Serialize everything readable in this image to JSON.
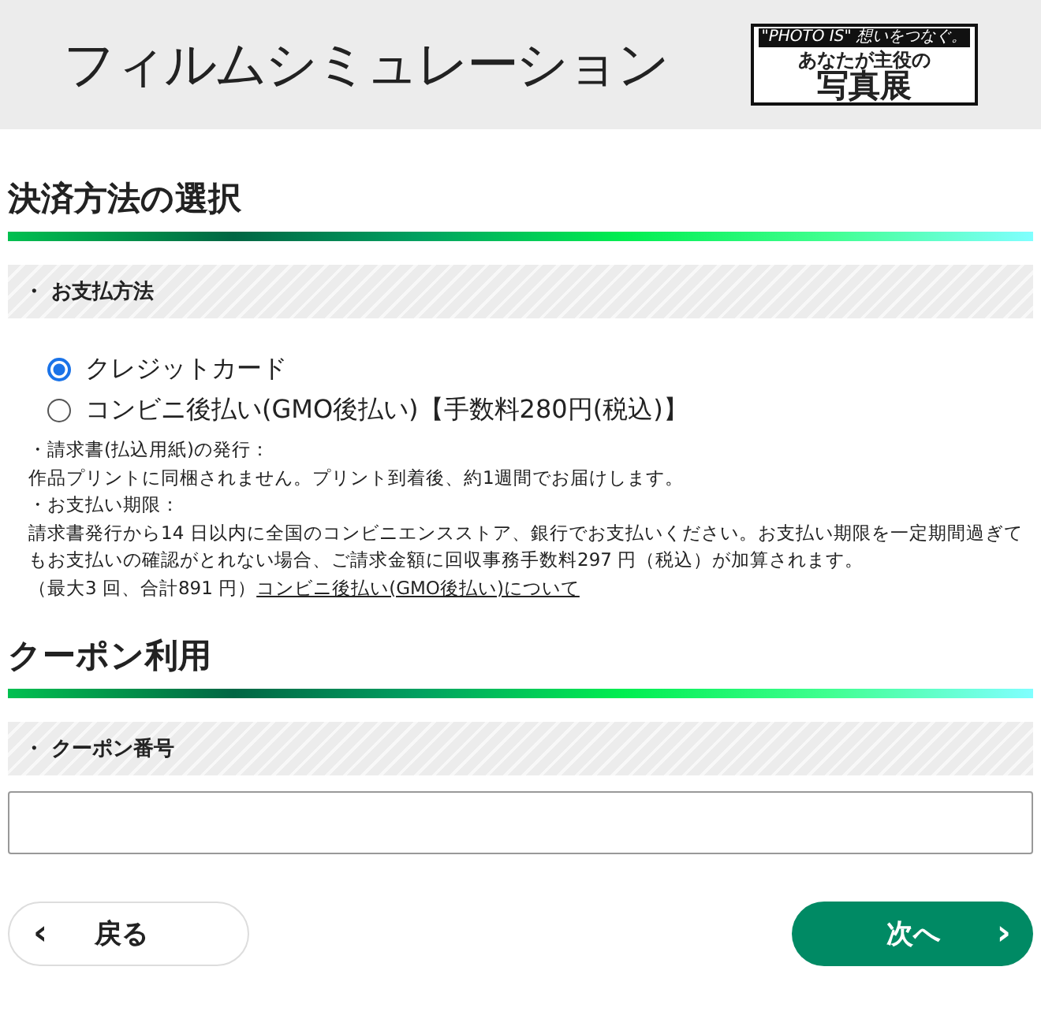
{
  "header": {
    "title": "フィルムシミュレーション",
    "logo": {
      "tagline": "\"PHOTO IS\" 想いをつなぐ。",
      "line1": "あなたが主役の",
      "line2": "写真展"
    }
  },
  "payment": {
    "heading": "決済方法の選択",
    "subheading": "・ お支払方法",
    "options": [
      {
        "label": "クレジットカード",
        "selected": true
      },
      {
        "label": "コンビニ後払い(GMO後払い)【手数料280円(税込)】",
        "selected": false
      }
    ],
    "notes": [
      "・請求書(払込用紙)の発行：",
      "作品プリントに同梱されません。プリント到着後、約1週間でお届けします。",
      "・お支払い期限：",
      "請求書発行から14 日以内に全国のコンビニエンスストア、銀行でお支払いください。お支払い期限を一定期間過ぎてもお支払いの確認がとれない場合、ご請求金額に回収事務手数料297 円（税込）が加算されます。"
    ],
    "limit_note": "（最大3 回、合計891 円）",
    "link": "コンビニ後払い(GMO後払い)について"
  },
  "coupon": {
    "heading": "クーポン利用",
    "subheading": "・ クーポン番号"
  },
  "buttons": {
    "back": {
      "icon": "‹",
      "label": "戻る"
    },
    "next": {
      "label": "次へ",
      "icon": "›"
    }
  }
}
